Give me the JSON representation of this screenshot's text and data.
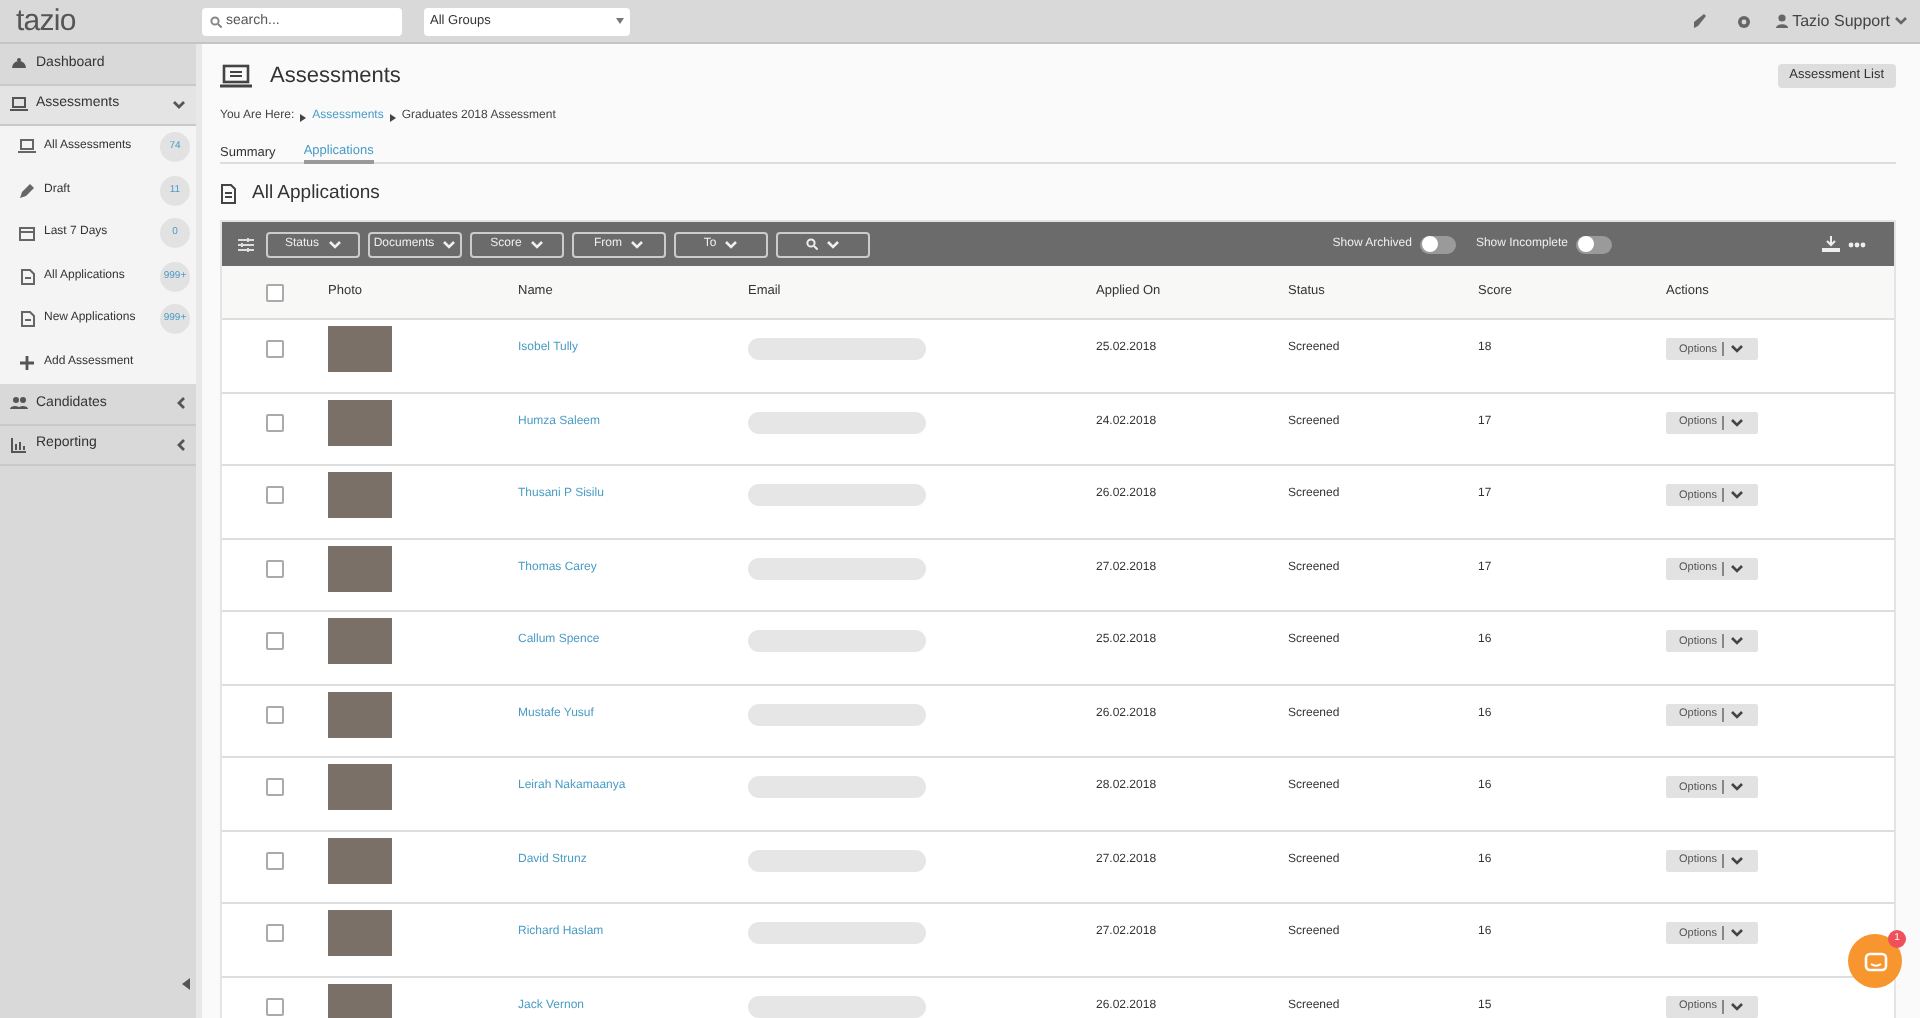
{
  "topbar": {
    "logo": "tazio",
    "search": {
      "placeholder": "search..."
    },
    "group_select": {
      "value": "All Groups"
    },
    "user": "Tazio Support"
  },
  "sidebar": {
    "items": [
      {
        "label": "Dashboard",
        "has_children": false
      },
      {
        "label": "Assessments",
        "expanded": true,
        "has_children": true,
        "children": [
          {
            "label": "All Assessments",
            "count": "74"
          },
          {
            "label": "Draft",
            "count": "11"
          },
          {
            "label": "Last 7 Days",
            "count": "0"
          },
          {
            "label": "All Applications",
            "count": "999+"
          },
          {
            "label": "New Applications",
            "count": "999+"
          },
          {
            "label": "Add Assessment"
          }
        ]
      },
      {
        "label": "Candidates",
        "expanded": false,
        "has_children": true
      },
      {
        "label": "Reporting",
        "expanded": false,
        "has_children": true
      }
    ]
  },
  "page": {
    "title": "Assessments",
    "action_button": "Assessment List",
    "breadcrumb": {
      "prefix": "You Are Here:",
      "items": [
        {
          "label": "Assessments",
          "link": true
        },
        {
          "label": "Graduates 2018 Assessment",
          "link": false
        }
      ]
    },
    "tabs": [
      {
        "label": "Summary",
        "selected": false
      },
      {
        "label": "Applications",
        "selected": true
      }
    ],
    "section_title": "All Applications"
  },
  "toolbar": {
    "filters": [
      "Status",
      "Documents",
      "Score",
      "From",
      "To"
    ],
    "toggles": [
      {
        "label": "Show Archived",
        "on": false
      },
      {
        "label": "Show Incomplete",
        "on": false
      }
    ]
  },
  "table": {
    "select_all_checked": false,
    "columns": [
      "Photo",
      "Name",
      "Email",
      "Applied On",
      "Status",
      "Score",
      "Actions"
    ],
    "rows": [
      {
        "checked": false,
        "name": "Isobel Tully",
        "applied_on": "25.02.2018",
        "status": "Screened",
        "score": "18",
        "action": "Options"
      },
      {
        "checked": false,
        "name": "Humza Saleem",
        "applied_on": "24.02.2018",
        "status": "Screened",
        "score": "17",
        "action": "Options"
      },
      {
        "checked": false,
        "name": "Thusani P Sisilu",
        "applied_on": "26.02.2018",
        "status": "Screened",
        "score": "17",
        "action": "Options"
      },
      {
        "checked": false,
        "name": "Thomas Carey",
        "applied_on": "27.02.2018",
        "status": "Screened",
        "score": "17",
        "action": "Options"
      },
      {
        "checked": false,
        "name": "Callum Spence",
        "applied_on": "25.02.2018",
        "status": "Screened",
        "score": "16",
        "action": "Options"
      },
      {
        "checked": false,
        "name": "Mustafe Yusuf",
        "applied_on": "26.02.2018",
        "status": "Screened",
        "score": "16",
        "action": "Options"
      },
      {
        "checked": false,
        "name": "Leirah Nakamaanya",
        "applied_on": "28.02.2018",
        "status": "Screened",
        "score": "16",
        "action": "Options"
      },
      {
        "checked": false,
        "name": "David Strunz",
        "applied_on": "27.02.2018",
        "status": "Screened",
        "score": "16",
        "action": "Options"
      },
      {
        "checked": false,
        "name": "Richard Haslam",
        "applied_on": "27.02.2018",
        "status": "Screened",
        "score": "16",
        "action": "Options"
      },
      {
        "checked": false,
        "name": "Jack Vernon",
        "applied_on": "26.02.2018",
        "status": "Screened",
        "score": "15",
        "action": "Options"
      }
    ]
  },
  "chat": {
    "badge": "1"
  }
}
